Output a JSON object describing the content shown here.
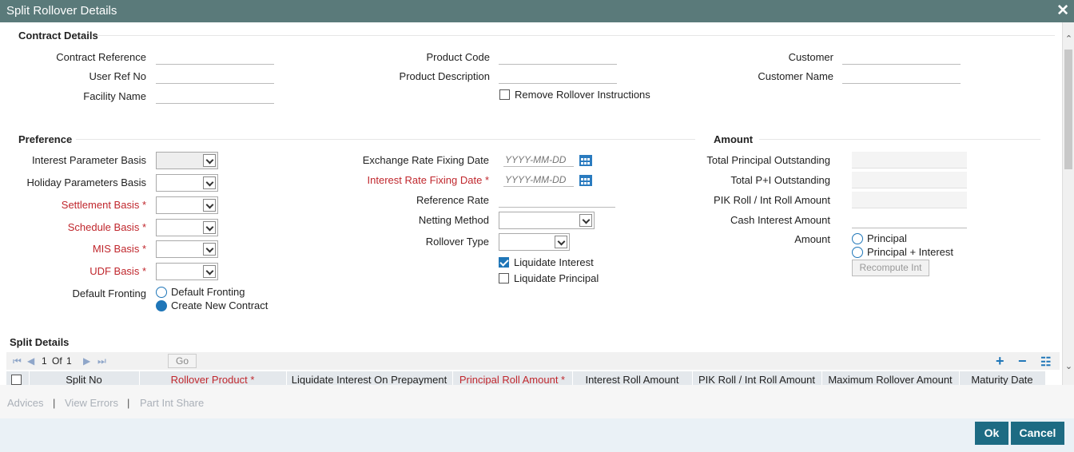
{
  "window": {
    "title": "Split Rollover Details"
  },
  "contract": {
    "section_title": "Contract Details",
    "contract_reference_label": "Contract Reference",
    "user_ref_label": "User Ref No",
    "facility_name_label": "Facility Name",
    "product_code_label": "Product Code",
    "product_description_label": "Product Description",
    "remove_rollover_label": "Remove Rollover Instructions",
    "customer_label": "Customer",
    "customer_name_label": "Customer Name"
  },
  "preference": {
    "section_title": "Preference",
    "interest_parameter_basis_label": "Interest Parameter Basis",
    "holiday_parameters_basis_label": "Holiday Parameters Basis",
    "settlement_basis_label": "Settlement Basis",
    "schedule_basis_label": "Schedule Basis",
    "mis_basis_label": "MIS Basis",
    "udf_basis_label": "UDF Basis",
    "default_fronting_label": "Default Fronting",
    "default_fronting_options": [
      "Default Fronting",
      "Create New Contract"
    ],
    "default_fronting_selected": "Create New Contract",
    "exchange_rate_fixing_date_label": "Exchange Rate Fixing Date",
    "interest_rate_fixing_date_label": "Interest Rate Fixing Date",
    "date_placeholder": "YYYY-MM-DD",
    "reference_rate_label": "Reference Rate",
    "netting_method_label": "Netting Method",
    "rollover_type_label": "Rollover Type",
    "liquidate_interest_label": "Liquidate Interest",
    "liquidate_interest_checked": true,
    "liquidate_principal_label": "Liquidate Principal",
    "liquidate_principal_checked": false
  },
  "amount": {
    "section_title": "Amount",
    "total_principal_outstanding_label": "Total Principal Outstanding",
    "total_pi_outstanding_label": "Total P+I Outstanding",
    "pik_roll_label": "PIK Roll / Int Roll Amount",
    "cash_interest_label": "Cash Interest Amount",
    "amount_label": "Amount",
    "amount_options": [
      "Principal",
      "Principal + Interest"
    ],
    "recompute_label": "Recompute Int"
  },
  "split": {
    "section_title": "Split Details",
    "page_current": "1",
    "page_of": "Of",
    "page_total": "1",
    "go_label": "Go",
    "columns": [
      "Split No",
      "Rollover Product",
      "Liquidate Interest On Prepayment",
      "Principal Roll Amount",
      "Interest Roll Amount",
      "PIK Roll / Int Roll Amount",
      "Maximum Rollover Amount",
      "Maturity Date"
    ]
  },
  "footer": {
    "links": [
      "Advices",
      "View Errors",
      "Part Int Share"
    ],
    "separator": "|",
    "ok_label": "Ok",
    "cancel_label": "Cancel"
  },
  "colors": {
    "title_bar": "#5a7a7a",
    "accent": "#1f76b8",
    "required": "#c0272d",
    "button": "#1d6b83"
  }
}
